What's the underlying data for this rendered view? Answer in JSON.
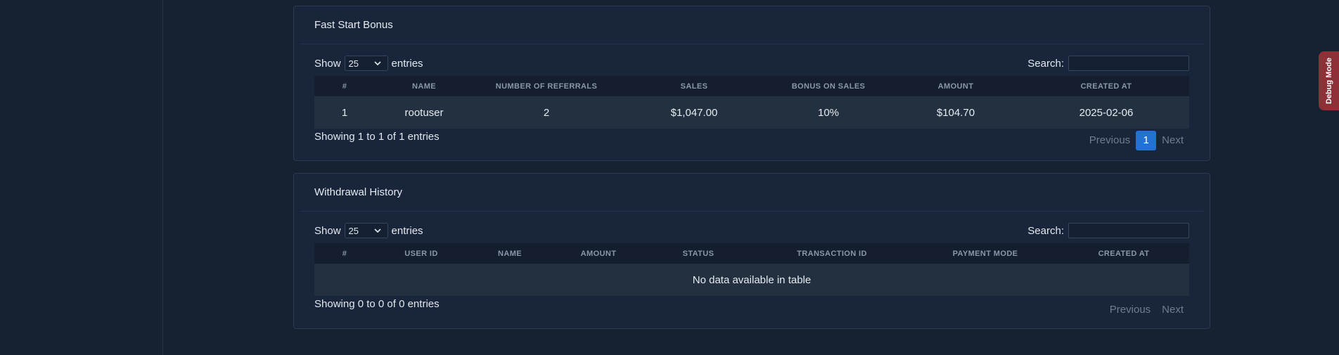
{
  "fast_start": {
    "title": "Fast Start Bonus",
    "show_label": "Show",
    "entries_value": "25",
    "entries_label": "entries",
    "search_label": "Search:",
    "columns": [
      "#",
      "NAME",
      "NUMBER OF REFERRALS",
      "SALES",
      "BONUS ON SALES",
      "AMOUNT",
      "CREATED AT"
    ],
    "rows": [
      [
        "1",
        "rootuser",
        "2",
        "$1,047.00",
        "10%",
        "$104.70",
        "2025-02-06"
      ]
    ],
    "info": "Showing 1 to 1 of 1 entries",
    "prev_label": "Previous",
    "page": "1",
    "next_label": "Next"
  },
  "withdrawal": {
    "title": "Withdrawal History",
    "show_label": "Show",
    "entries_value": "25",
    "entries_label": "entries",
    "search_label": "Search:",
    "columns": [
      "#",
      "USER ID",
      "NAME",
      "AMOUNT",
      "STATUS",
      "TRANSACTION ID",
      "PAYMENT MODE",
      "CREATED AT"
    ],
    "empty_text": "No data available in table",
    "info": "Showing 0 to 0 of 0 entries",
    "prev_label": "Previous",
    "next_label": "Next"
  },
  "debug_tab": {
    "label": "Debug Mode",
    "color": "#8f2f36"
  },
  "colors": {
    "accent": "#2371d3",
    "background": "#162131"
  }
}
